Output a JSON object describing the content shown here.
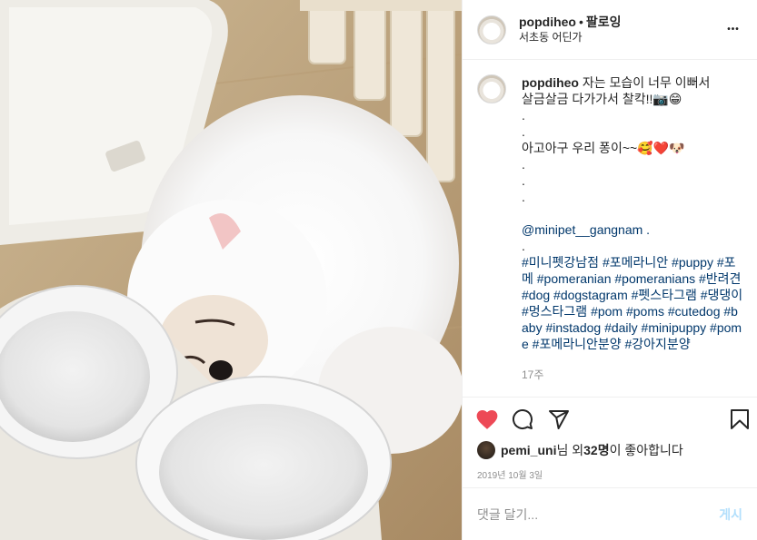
{
  "header": {
    "username": "popdiheo",
    "separator": "•",
    "follow_label": "팔로잉",
    "location": "서초동 어딘가",
    "more_glyph": "•••"
  },
  "caption": {
    "username": "popdiheo",
    "lines": [
      " 자는 모습이 너무 이뻐서",
      "살금살금 다가가서 찰칵!!📷😁",
      ".",
      ".",
      "아고아구 우리 퐁이~~🥰❤️🐶",
      ".",
      ".",
      ".",
      "",
      "@minipet__gangnam .",
      ".",
      "#미니펫강남점 #포메라니안 #puppy #포메 #pomeranian #pomeranians #반려견 #dog #dogstagram #펫스타그램 #댕댕이 #멍스타그램 #pom #poms #cutedog #baby #instadog #daily #minipuppy #pome #포메라니안분양 #강아지분양"
    ],
    "age": "17주"
  },
  "actions": {
    "like_icon": "heart-filled-icon",
    "comment_icon": "comment-icon",
    "share_icon": "share-icon",
    "save_icon": "bookmark-icon",
    "like_color": "#ed4956"
  },
  "likes": {
    "liker": "pemi_uni",
    "text_mid": "님 외 ",
    "count": "32명",
    "text_end": "이 좋아합니다"
  },
  "date": "2019년 10월 3일",
  "add_comment": {
    "placeholder": "댓글 달기...",
    "post_label": "게시",
    "post_color": "#b2dffc"
  }
}
